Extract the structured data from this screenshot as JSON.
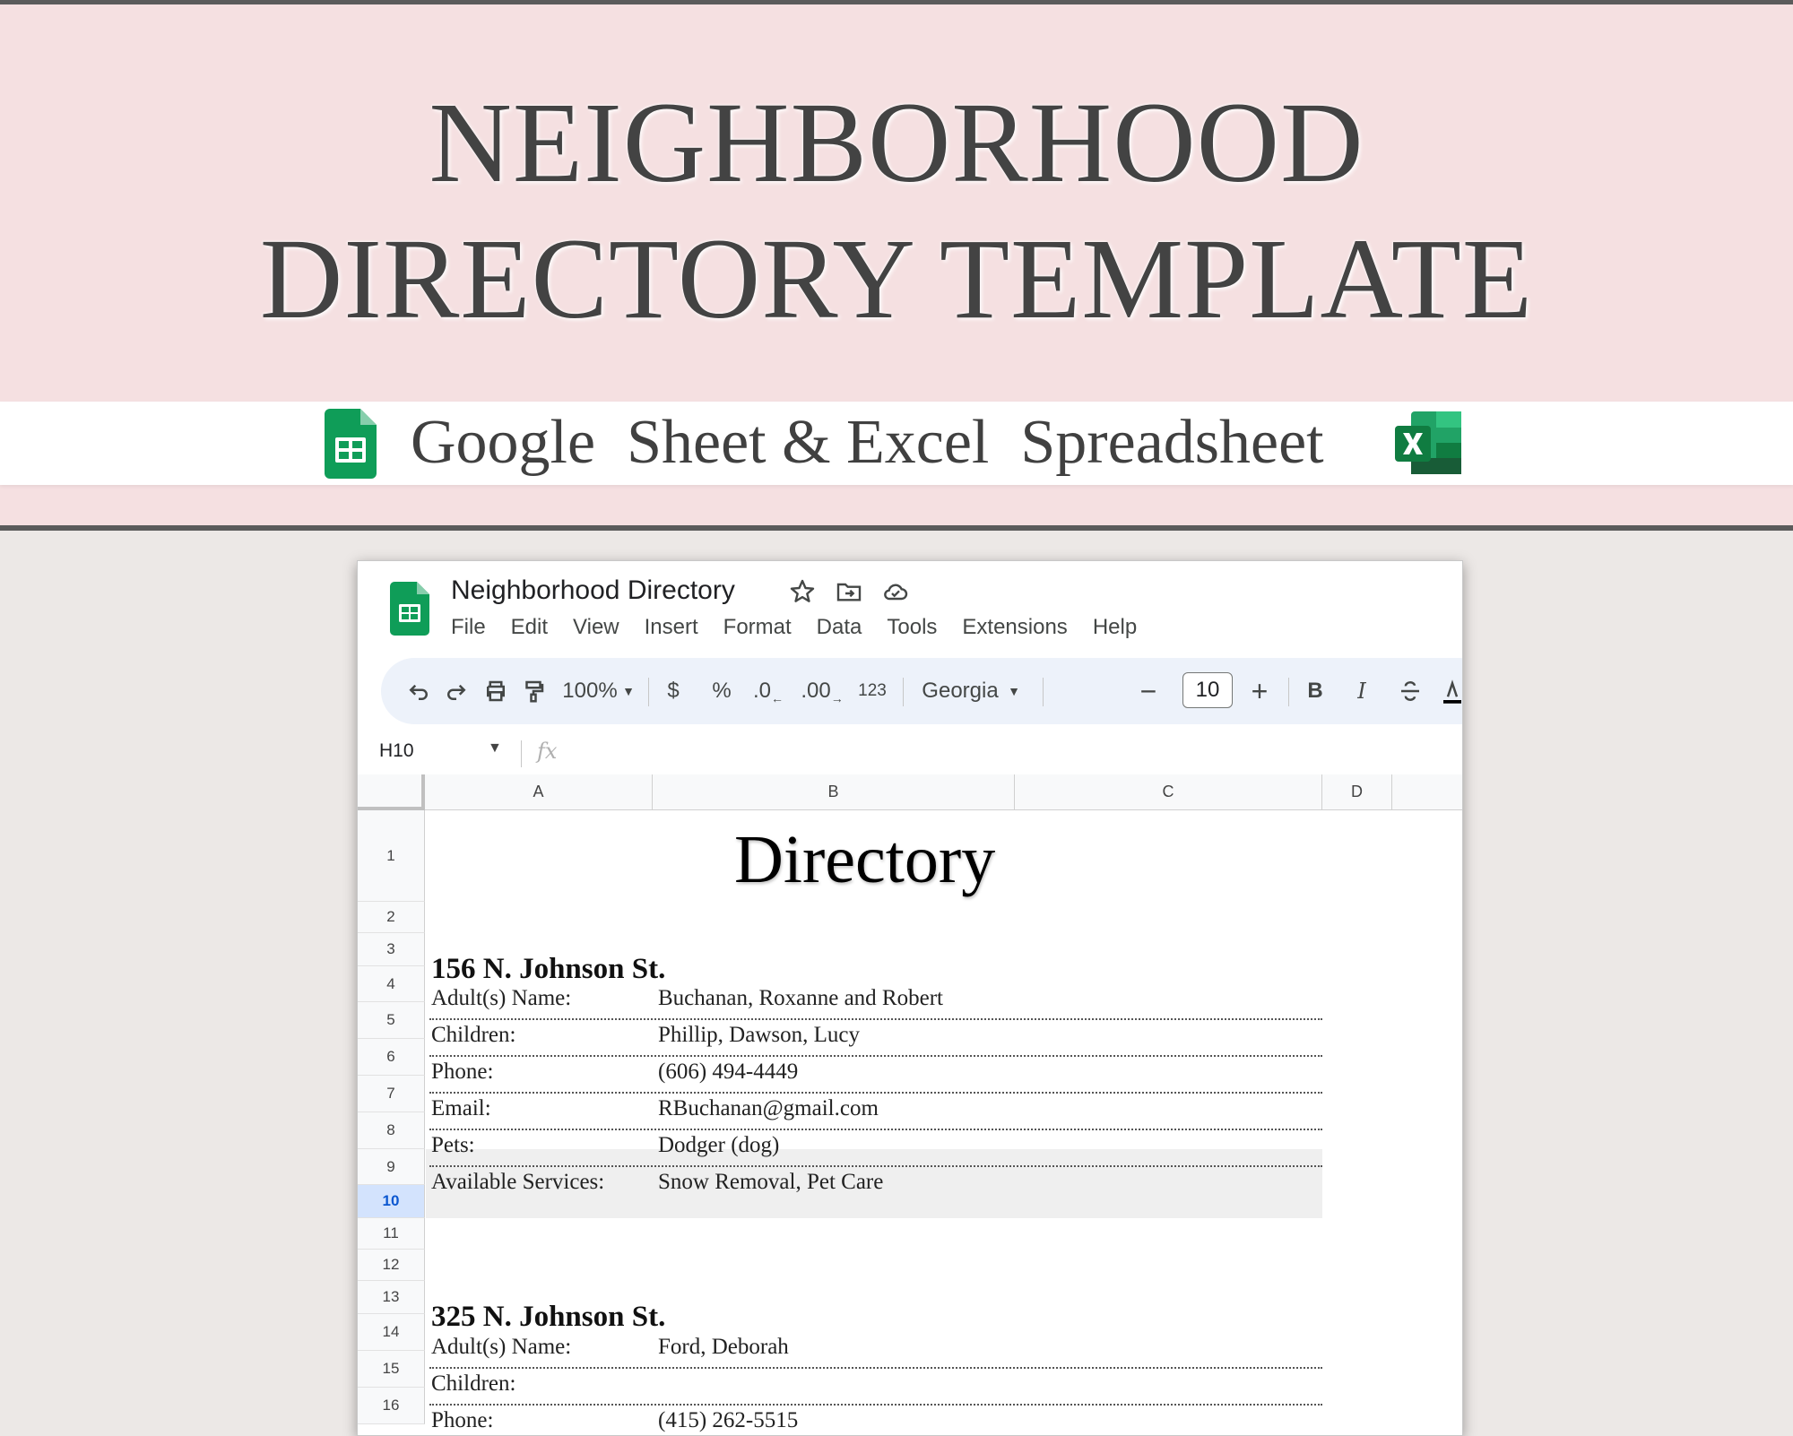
{
  "banner": {
    "title_line1": "NEIGHBORHOOD",
    "title_line2": "DIRECTORY TEMPLATE",
    "subtitle": "Google  Sheet & Excel  Spreadsheet"
  },
  "sheet": {
    "doc_title": "Neighborhood Directory",
    "menu": [
      "File",
      "Edit",
      "View",
      "Insert",
      "Format",
      "Data",
      "Tools",
      "Extensions",
      "Help"
    ],
    "toolbar": {
      "zoom": "100%",
      "currency": "$",
      "percent": "%",
      "decrease_decimal": ".0",
      "increase_decimal": ".00",
      "number_format": "123",
      "font": "Georgia",
      "font_size": "10",
      "bold": "B",
      "italic": "I"
    },
    "name_box": "H10",
    "fx_label": "fx",
    "columns": [
      "A",
      "B",
      "C",
      "D"
    ],
    "rows": [
      "1",
      "2",
      "3",
      "4",
      "5",
      "6",
      "7",
      "8",
      "9",
      "10",
      "11",
      "12",
      "13",
      "14",
      "15",
      "16"
    ],
    "selected_row": "10",
    "cells": {
      "heading": "Directory",
      "entries": [
        {
          "address": "156 N. Johnson St.",
          "fields": [
            {
              "label": "Adult(s) Name:",
              "value": "Buchanan, Roxanne and Robert"
            },
            {
              "label": "Children:",
              "value": "Phillip, Dawson, Lucy"
            },
            {
              "label": "Phone:",
              "value": "(606) 494-4449"
            },
            {
              "label": "Email:",
              "value": "RBuchanan@gmail.com"
            },
            {
              "label": "Pets:",
              "value": "Dodger (dog)"
            },
            {
              "label": "Available Services:",
              "value": "Snow Removal, Pet Care"
            }
          ]
        },
        {
          "address": "325 N. Johnson St.",
          "fields": [
            {
              "label": "Adult(s) Name:",
              "value": "Ford, Deborah"
            },
            {
              "label": "Children:",
              "value": ""
            },
            {
              "label": "Phone:",
              "value": "(415) 262-5515"
            }
          ]
        }
      ]
    }
  },
  "colors": {
    "banner_pink": "#f5e0e1",
    "sheets_green": "#0f9d58",
    "excel_green": "#107c41",
    "selection_blue": "#d3e3fd"
  }
}
